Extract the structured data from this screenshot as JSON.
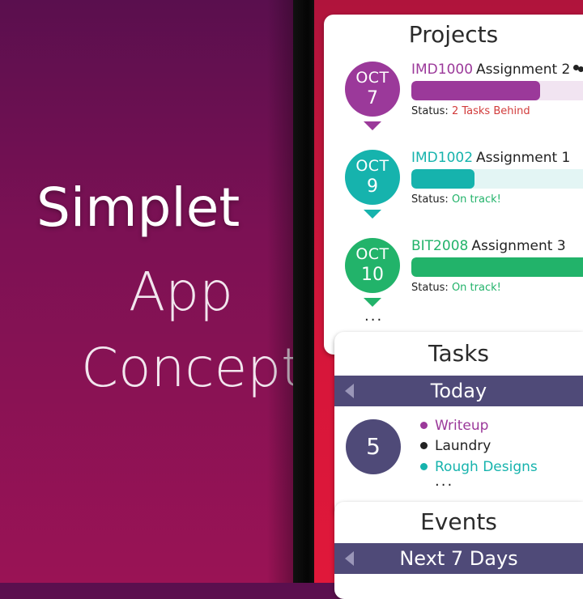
{
  "hero": {
    "line1": "Simplet",
    "line2": "App",
    "line3": "Concept"
  },
  "colors": {
    "purple": "#9b399a",
    "teal": "#16b3ad",
    "green": "#22b36a",
    "slate": "#4f4a78",
    "red": "#d6163a"
  },
  "projects": {
    "title": "Projects",
    "items": [
      {
        "month": "OCT",
        "day": "7",
        "code": "IMD1000",
        "name": "Assignment 2",
        "status_label": "Status:",
        "status_text": "2 Tasks Behind",
        "progress": 0.69,
        "shared": true
      },
      {
        "month": "OCT",
        "day": "9",
        "code": "IMD1002",
        "name": "Assignment 1",
        "status_label": "Status:",
        "status_text": "On track!",
        "progress": 0.34
      },
      {
        "month": "OCT",
        "day": "10",
        "code": "BIT2008",
        "name": "Assignment 3",
        "status_label": "Status:",
        "status_text": "On track!",
        "progress": 1.0
      }
    ],
    "more": "..."
  },
  "tasks": {
    "title": "Tasks",
    "period": "Today",
    "count": "5",
    "items": [
      {
        "label": "Writeup"
      },
      {
        "label": "Laundry"
      },
      {
        "label": "Rough Designs"
      }
    ],
    "more": "..."
  },
  "events": {
    "title": "Events",
    "period": "Next 7 Days"
  }
}
